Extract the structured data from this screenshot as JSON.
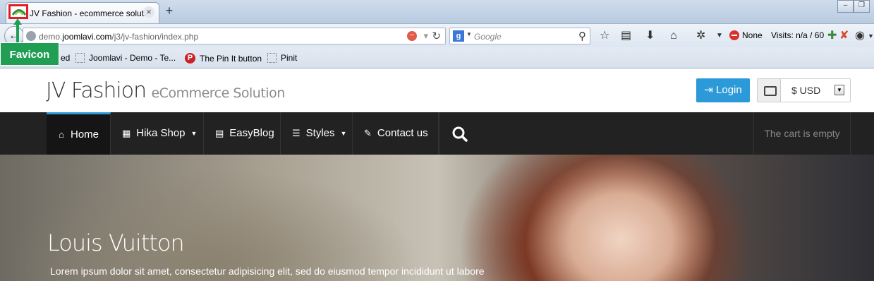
{
  "browser": {
    "tab_title": "JV Fashion - ecommerce soluti...",
    "tab_close": "×",
    "new_tab": "+",
    "url": {
      "prefix": "demo.",
      "domain": "joomlavi.com",
      "path": "/j3/jv-fashion/index.php"
    },
    "search": {
      "engine": "g",
      "placeholder": "Google"
    },
    "toolbar": {
      "none_label": "None",
      "visits_label": "Visits: n/a / 60"
    },
    "bookmarks": [
      {
        "label": "ed",
        "icon": "page-icon"
      },
      {
        "label": "Joomlavi - Demo - Te...",
        "icon": "page-icon"
      },
      {
        "label": "The Pin It button",
        "icon": "pinterest-icon"
      },
      {
        "label": "Pinit",
        "icon": "page-icon"
      }
    ]
  },
  "annotation": {
    "label": "Favicon",
    "color": "#1f9e54",
    "box_color": "#e21d24"
  },
  "site": {
    "brand_name": "JV Fashion",
    "brand_tagline": "eCommerce Solution",
    "login_label": "Login",
    "currency": "$ USD",
    "nav": [
      {
        "label": "Home",
        "icon": "home-icon",
        "active": true
      },
      {
        "label": "Hika Shop",
        "icon": "grid-icon",
        "dropdown": true
      },
      {
        "label": "EasyBlog",
        "icon": "document-icon"
      },
      {
        "label": "Styles",
        "icon": "list-icon",
        "dropdown": true
      },
      {
        "label": "Contact us",
        "icon": "edit-icon"
      }
    ],
    "cart_text": "The cart is empty",
    "hero": {
      "title": "Louis Vuitton",
      "text": "Lorem ipsum dolor sit amet, consectetur adipisicing elit, sed do eiusmod tempor incididunt ut labore"
    },
    "accent_color": "#2c9ad8"
  }
}
